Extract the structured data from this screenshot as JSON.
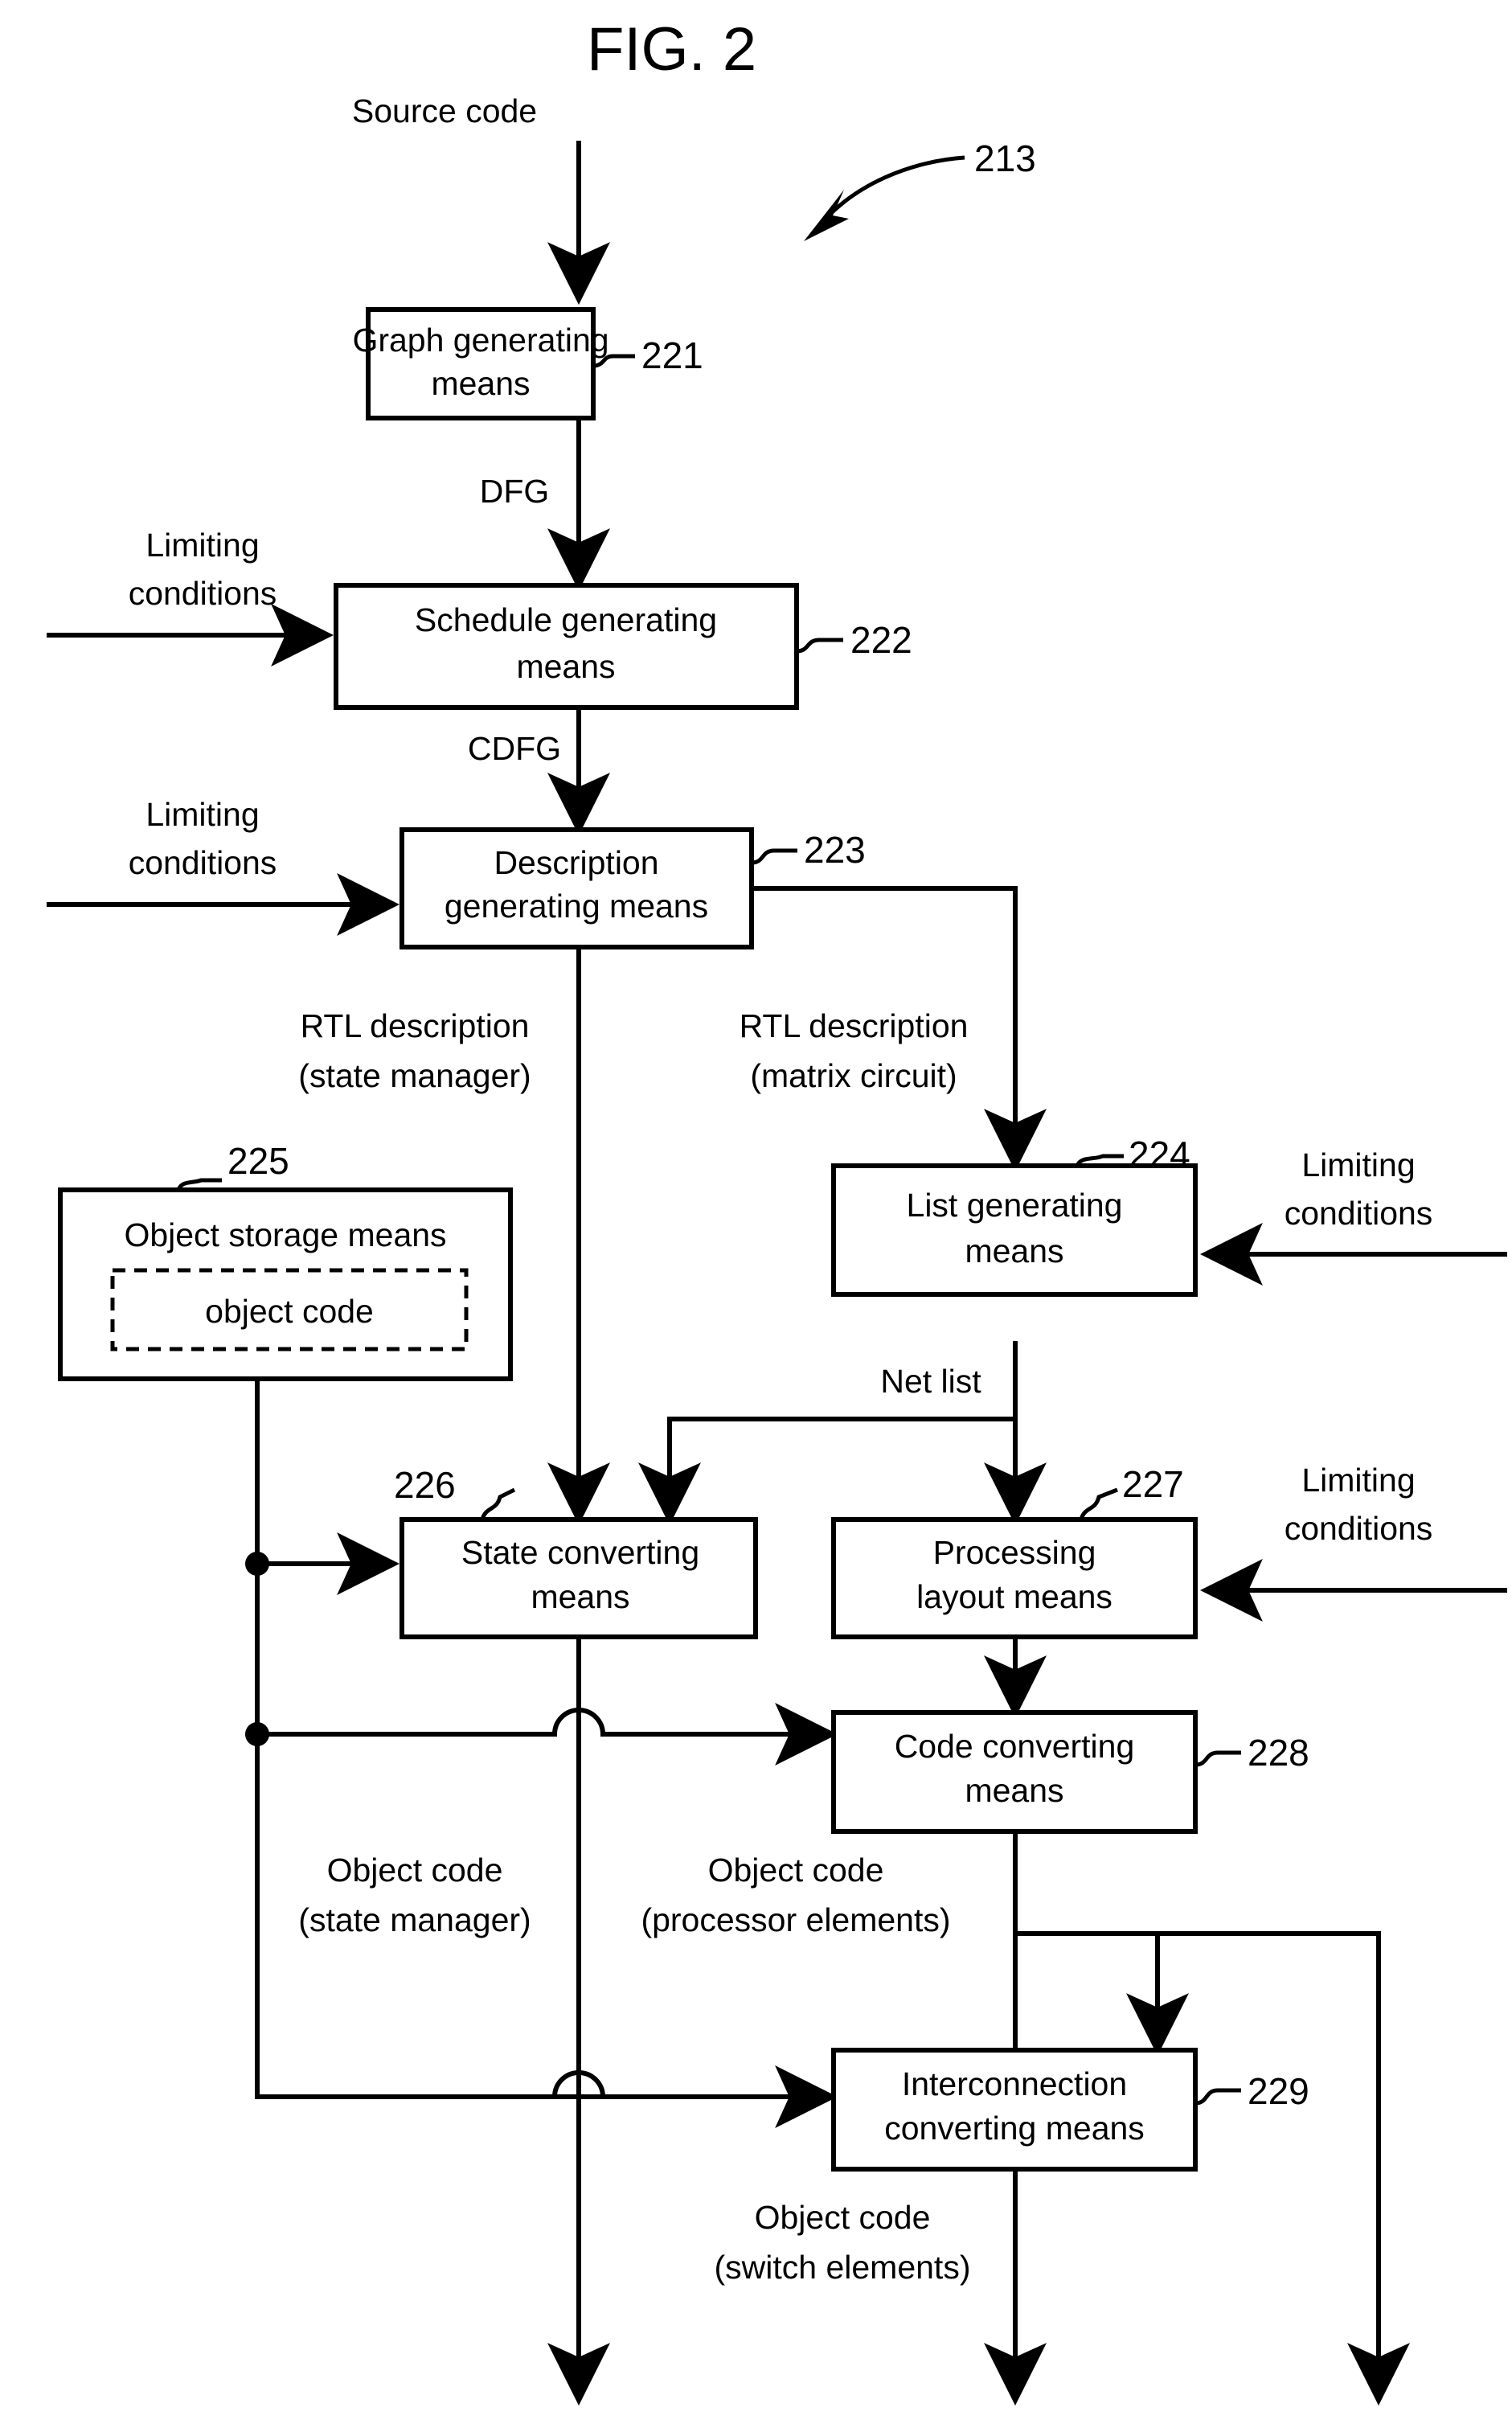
{
  "figure": {
    "title": "FIG. 2",
    "assembly_ref": "213"
  },
  "boxes": [
    {
      "id": "graph",
      "ref": "221",
      "lines": [
        "Graph generating",
        "means"
      ]
    },
    {
      "id": "schedule",
      "ref": "222",
      "lines": [
        "Schedule generating",
        "means"
      ]
    },
    {
      "id": "description",
      "ref": "223",
      "lines": [
        "Description",
        "generating means"
      ]
    },
    {
      "id": "list",
      "ref": "224",
      "lines": [
        "List generating",
        "means"
      ]
    },
    {
      "id": "storage",
      "ref": "225",
      "lines": [
        "Object storage means"
      ],
      "inner": "object code"
    },
    {
      "id": "stateconv",
      "ref": "226",
      "lines": [
        "State converting",
        "means"
      ]
    },
    {
      "id": "layout",
      "ref": "227",
      "lines": [
        "Processing",
        "layout means"
      ]
    },
    {
      "id": "codeconv",
      "ref": "228",
      "lines": [
        "Code converting",
        "means"
      ]
    },
    {
      "id": "interconn",
      "ref": "229",
      "lines": [
        "Interconnection",
        "converting means"
      ]
    }
  ],
  "edge_labels": {
    "source_code": "Source code",
    "dfg": "DFG",
    "cdfg": "CDFG",
    "limiting_1_l1": "Limiting",
    "limiting_1_l2": "conditions",
    "limiting_2_l1": "Limiting",
    "limiting_2_l2": "conditions",
    "limiting_3_l1": "Limiting",
    "limiting_3_l2": "conditions",
    "limiting_4_l1": "Limiting",
    "limiting_4_l2": "conditions",
    "rtl_state_l1": "RTL description",
    "rtl_state_l2": "(state manager)",
    "rtl_matrix_l1": "RTL description",
    "rtl_matrix_l2": "(matrix circuit)",
    "net_list": "Net list",
    "obj_state_l1": "Object code",
    "obj_state_l2": "(state manager)",
    "obj_proc_l1": "Object code",
    "obj_proc_l2": "(processor elements)",
    "obj_switch_l1": "Object code",
    "obj_switch_l2": "(switch elements)"
  },
  "refs": {
    "r213": "213",
    "r221": "221",
    "r222": "222",
    "r223": "223",
    "r224": "224",
    "r225": "225",
    "r226": "226",
    "r227": "227",
    "r228": "228",
    "r229": "229"
  },
  "colors": {
    "ink": "#000000",
    "paper": "#ffffff"
  }
}
